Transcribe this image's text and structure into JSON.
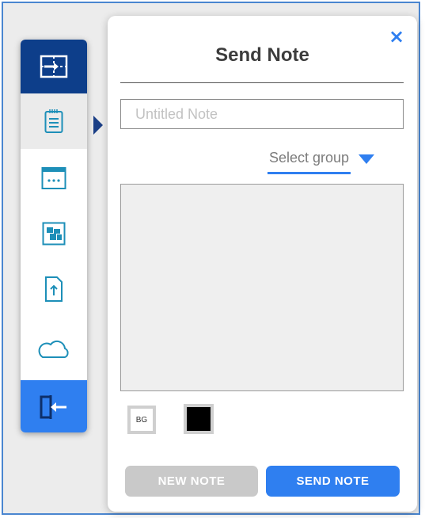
{
  "colors": {
    "accent": "#2f7ff0",
    "sidebar_dark": "#0d3e8a",
    "disabled": "#c9c9c9"
  },
  "sidebar": {
    "items": [
      {
        "icon": "import-icon",
        "active": true
      },
      {
        "icon": "note-icon",
        "selected": true
      },
      {
        "icon": "calendar-icon"
      },
      {
        "icon": "widgets-icon"
      },
      {
        "icon": "upload-icon"
      },
      {
        "icon": "cloud-icon"
      },
      {
        "icon": "exit-icon"
      }
    ]
  },
  "panel": {
    "title": "Send Note",
    "close_icon": "×",
    "note_title_placeholder": "Untitled Note",
    "group_select_label": "Select group",
    "bg_button_label": "BG",
    "new_note_label": "NEW NOTE",
    "send_note_label": "SEND NOTE"
  }
}
